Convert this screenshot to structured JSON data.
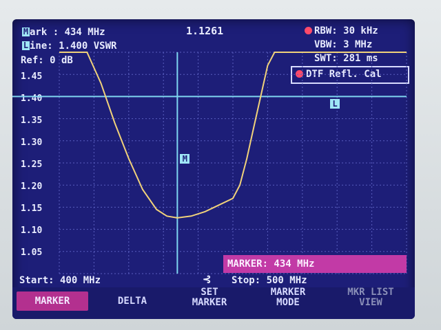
{
  "header": {
    "mark_label": "ark : 434 MHz",
    "mark_letter": "M",
    "line_label": "ine: 1.400 VSWR",
    "line_letter": "L",
    "ref_label": "Ref: 0 dB",
    "marker_readout": "1.1261",
    "rbw": "RBW: 30 kHz",
    "vbw": "VBW: 3 MHz",
    "swt": "SWT: 281 ms",
    "dtf_label": "DTF Refl. Cal"
  },
  "colors": {
    "screen_bg": "#1d1e78",
    "trace": "#f1d27a",
    "grid": "#5a5fc0",
    "marker_line": "#7fd6f0",
    "limit_line": "#7fd6f0",
    "status_dot": "#ff4a6a",
    "marker_banner": "#c23aa6"
  },
  "chart_data": {
    "type": "line",
    "title": "",
    "xlabel": "",
    "ylabel": "VSWR",
    "x_start_mhz": 400,
    "x_stop_mhz": 500,
    "y_ticks": [
      "1.45",
      "1.40",
      "1.35",
      "1.30",
      "1.25",
      "1.20",
      "1.15",
      "1.10",
      "1.05"
    ],
    "ylim": [
      1.0,
      1.5
    ],
    "limit_line": 1.4,
    "marker": {
      "x": 434,
      "y": 1.1261,
      "label": "M"
    },
    "series": [
      {
        "x": [
          400,
          404,
          408,
          412,
          416,
          420,
          424,
          428,
          431,
          434,
          438,
          442,
          446,
          450,
          452,
          454,
          456,
          458,
          460,
          462,
          500
        ],
        "y": [
          1.5,
          1.5,
          1.5,
          1.43,
          1.34,
          1.26,
          1.19,
          1.145,
          1.13,
          1.126,
          1.13,
          1.14,
          1.155,
          1.17,
          1.2,
          1.26,
          1.33,
          1.4,
          1.47,
          1.5,
          1.5
        ]
      }
    ]
  },
  "footer": {
    "start": "Start: 400 MHz",
    "stop": "Stop: 500 MHz",
    "marker_banner": "MARKER: 434 MHz"
  },
  "softkeys": [
    {
      "label": "MARKER",
      "state": "active"
    },
    {
      "label": "DELTA",
      "state": "normal"
    },
    {
      "label": "SET\nMARKER",
      "state": "normal"
    },
    {
      "label": "MARKER\nMODE",
      "state": "normal"
    },
    {
      "label": "MKR LIST\nVIEW",
      "state": "disabled"
    }
  ]
}
